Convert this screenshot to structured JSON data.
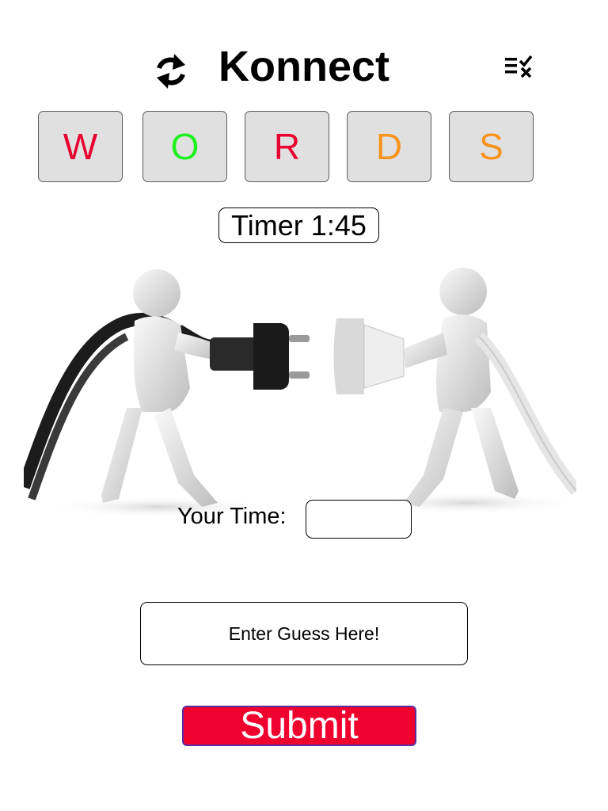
{
  "header": {
    "title": "Konnect",
    "refresh_icon": "refresh-icon",
    "menu_icon": "checklist-clear-icon"
  },
  "tiles": [
    {
      "letter": "W",
      "color": "#e8002f"
    },
    {
      "letter": "O",
      "color": "#1ff01f"
    },
    {
      "letter": "R",
      "color": "#e8002f"
    },
    {
      "letter": "D",
      "color": "#f7941d"
    },
    {
      "letter": "S",
      "color": "#f7941d"
    }
  ],
  "timer": {
    "label": "Timer 1:45"
  },
  "illustration": {
    "description_icon": "plug-connection-illustration"
  },
  "your_time": {
    "label": "Your Time:",
    "value": ""
  },
  "guess": {
    "placeholder": "Enter Guess Here!"
  },
  "submit": {
    "label": "Submit",
    "color": "#f0022f"
  }
}
